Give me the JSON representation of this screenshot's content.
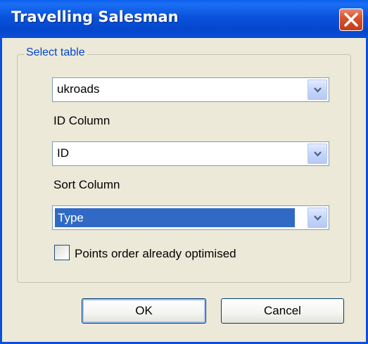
{
  "dialog": {
    "title": "Travelling Salesman",
    "close_icon": "close-x-icon"
  },
  "group": {
    "legend": "Select table"
  },
  "table_select": {
    "value": "ukroads",
    "icon": "chevron-down-icon"
  },
  "id_column": {
    "label": "ID Column",
    "value": "ID",
    "icon": "chevron-down-icon"
  },
  "sort_column": {
    "label": "Sort Column",
    "value": "Type",
    "icon": "chevron-down-icon"
  },
  "optimised_checkbox": {
    "label": "Points order already optimised",
    "checked": false
  },
  "buttons": {
    "ok": "OK",
    "cancel": "Cancel"
  },
  "colors": {
    "titlebar": "#0a52dc",
    "window_bg": "#ece9d8",
    "legend_text": "#0046d5",
    "selection": "#316ac5",
    "close_button": "#d8542e"
  }
}
